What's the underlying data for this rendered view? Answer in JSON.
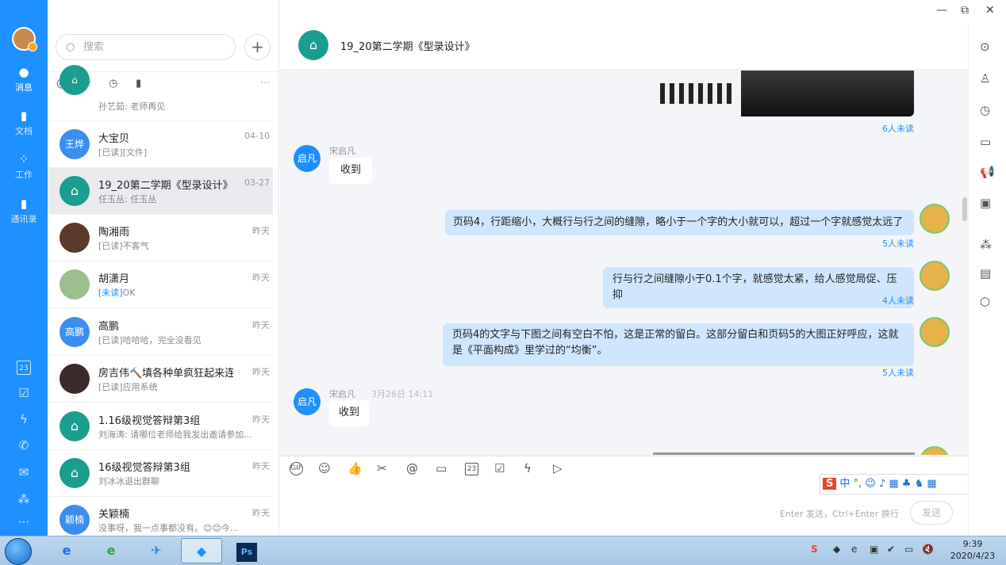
{
  "nav": {
    "items": [
      {
        "label": "消息",
        "icon": "chat-bubble-icon"
      },
      {
        "label": "文档",
        "icon": "folder-icon"
      },
      {
        "label": "工作",
        "icon": "apps-grid-icon"
      },
      {
        "label": "通讯录",
        "icon": "contacts-icon"
      }
    ],
    "bottom_icons": [
      "calendar-icon",
      "task-check-icon",
      "lightning-icon",
      "phone-icon",
      "mail-icon",
      "network-icon",
      "more-icon"
    ],
    "calendar_day": "23"
  },
  "list": {
    "search_placeholder": "搜索",
    "add_label": "+",
    "filter_icons": [
      "at-icon",
      "star-icon",
      "history-icon",
      "archive-icon",
      "more-icon"
    ],
    "conversations": [
      {
        "name": "",
        "msg": "孙艺茹: 老师再见",
        "time": "",
        "avatar_text": "",
        "avatar_color": "#1a9e8f"
      },
      {
        "name": "大宝贝",
        "msg": "[已读][文件]",
        "time": "04-10",
        "avatar_text": "王烨",
        "avatar_color": "#3a8ef0"
      },
      {
        "name": "19_20第二学期《型录设计》",
        "msg": "任玉丛: 任玉丛",
        "time": "03-27",
        "avatar_text": "",
        "avatar_color": "#1a9e8f"
      },
      {
        "name": "陶湘雨",
        "msg": "[已读]不客气",
        "time": "昨天",
        "avatar_text": "",
        "avatar_color": "#5a3a2a"
      },
      {
        "name": "胡潇月",
        "msg_prefix": "[未读]",
        "msg": "OK",
        "time": "昨天",
        "avatar_text": "",
        "avatar_color": "#9dbf8e"
      },
      {
        "name": "高鹏",
        "msg": "[已读]哈哈哈，完全没看见",
        "time": "昨天",
        "avatar_text": "高鹏",
        "avatar_color": "#3a8ef0"
      },
      {
        "name": "房吉伟🔨填各种单疯狂起来连觉...",
        "msg": "[已读]应用系统",
        "time": "昨天",
        "avatar_text": "",
        "avatar_color": "#3a2a2a"
      },
      {
        "name": "1.16级视觉答辩第3组",
        "msg": "刘海涛: 请哪位老师给我发出邀请参加...",
        "time": "昨天",
        "avatar_text": "",
        "avatar_color": "#1a9e8f"
      },
      {
        "name": "16级视觉答辩第3组",
        "msg": "刘冰冰退出群聊",
        "time": "昨天",
        "avatar_text": "",
        "avatar_color": "#1a9e8f"
      },
      {
        "name": "关颖楠",
        "msg": "没事呀，我一点事都没有。😊😊今...",
        "time": "昨天",
        "avatar_text": "颖楠",
        "avatar_color": "#3a8ef0"
      }
    ]
  },
  "chat": {
    "title": "19_20第二学期《型录设计》",
    "messages": [
      {
        "type": "image",
        "read": "6人未读"
      },
      {
        "type": "text",
        "from": "宋启凡",
        "avatar": "启凡",
        "text": "收到"
      },
      {
        "type": "text",
        "mine": true,
        "text": "页码4，行距缩小，大概行与行之间的缝隙，略小于一个字的大小就可以，超过一个字就感觉太远了",
        "read": "5人未读"
      },
      {
        "type": "text",
        "mine": true,
        "text": "行与行之间缝隙小于0.1个字，就感觉太紧，给人感觉局促、压抑",
        "read": "4人未读"
      },
      {
        "type": "text",
        "mine": true,
        "text": "页码4的文字与下图之间有空白不怕，这是正常的留白。这部分留白和页码5的大图正好呼应，这就是《平面构成》里学过的“均衡”。",
        "read": "5人未读"
      },
      {
        "type": "text",
        "from": "宋启凡",
        "time": "3月26日 14:11",
        "avatar": "启凡",
        "text": "收到"
      }
    ],
    "toolbar_icons": [
      "gif-icon",
      "emoji-icon",
      "thumbs-up-icon",
      "scissors-icon",
      "at-icon",
      "folder-icon",
      "calendar-icon",
      "task-check-icon",
      "lightning-icon",
      "video-icon"
    ],
    "calendar_day": "23",
    "ime_text": "中 °, ☺ ♪ ▦ ♣ ♞ ▦",
    "send_hint": "Enter 发送，Ctrl+Enter 换行",
    "send_label": "发送"
  },
  "right_panel_icons": [
    "more-icon",
    "add-member-icon",
    "history-icon",
    "folder-icon",
    "announcement-icon",
    "live-icon",
    "network-icon",
    "notebook-icon",
    "cube-add-icon"
  ],
  "window": {
    "minimize": "—",
    "restore": "⧉",
    "close": "✕"
  },
  "taskbar": {
    "time": "9:39",
    "date": "2020/4/23"
  }
}
